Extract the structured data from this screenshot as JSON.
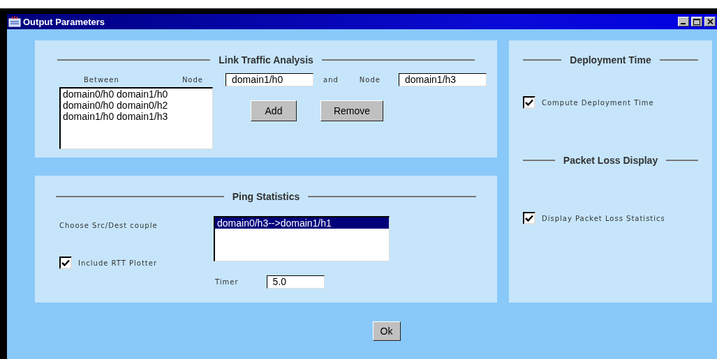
{
  "window": {
    "title": "Output Parameters"
  },
  "link_traffic": {
    "title": "Link Traffic Analysis",
    "between_label": "Between",
    "node_label_1": "Node",
    "node_1": "domain1/h0",
    "and_label": "and",
    "node_label_2": "Node",
    "node_2": "domain1/h3",
    "links": [
      {
        "text": "domain0/h0 domain1/h0",
        "selected": false
      },
      {
        "text": "domain0/h0 domain0/h2",
        "selected": false
      },
      {
        "text": "domain1/h0 domain1/h3",
        "selected": false
      }
    ],
    "buttons": [
      "Add",
      "Remove"
    ]
  },
  "ping": {
    "title": "Ping Statistics",
    "couple_label": "Choose Src/Dest couple",
    "couples": [
      {
        "text": "domain0/h3-->domain1/h1",
        "selected": true
      }
    ],
    "rtt_plotter": {
      "label": "Include RTT Plotter",
      "checked": true
    },
    "timer_label": "Timer",
    "timer": "5.0"
  },
  "deployment": {
    "title": "Deployment Time",
    "option": {
      "label": "Compute Deployment Time",
      "checked": true
    }
  },
  "packet_loss": {
    "title": "Packet Loss Display",
    "option": {
      "label": "Display Packet Loss Statistics",
      "checked": true
    }
  },
  "ok_button": "Ok"
}
